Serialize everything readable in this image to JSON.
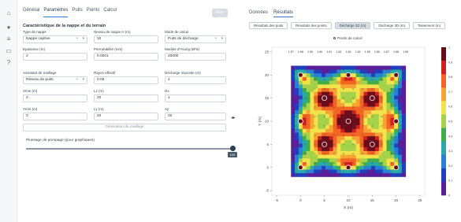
{
  "rail": {
    "icons": [
      "home-icon",
      "database-icon",
      "layers-icon",
      "monitor-icon",
      "help-icon"
    ]
  },
  "left_tabs": [
    "Général",
    "Paramètres",
    "Puits",
    "Points",
    "Calcul"
  ],
  "run_button": "Run",
  "section_title": "Caractéristique de la nappe et du terrain",
  "fields": {
    "type_nappe": {
      "label": "Type de nappe",
      "value": "Nappe captive"
    },
    "niveau_nappe": {
      "label": "Niveau de nappe H (m)",
      "value": "10"
    },
    "mode_calcul": {
      "label": "Mode de calcul",
      "value": "Puits de décharge"
    },
    "epaisseur": {
      "label": "Epaisseur (m)",
      "value": "2"
    },
    "permeabilite": {
      "label": "Perméabilité (m/s)",
      "value": "0.0001"
    },
    "module_young": {
      "label": "Module d'Young (kPa)",
      "value": "20000"
    },
    "assistant_maillage": {
      "label": "Assistant de maillage",
      "value": "Réseau de puits"
    },
    "rayon_effectif": {
      "label": "Rayon effectif",
      "value": "0.06"
    },
    "decharge_imposee": {
      "label": "Décharge imposée (m)",
      "value": "4"
    },
    "xmin": {
      "label": "Xmin (m)",
      "value": "0"
    },
    "lx": {
      "label": "Lx (m)",
      "value": "20"
    },
    "dx": {
      "label": "Dx",
      "value": "4"
    },
    "ymin": {
      "label": "Ymin (m)",
      "value": "0"
    },
    "ly": {
      "label": "Ly (m)",
      "value": "20"
    },
    "ay": {
      "label": "Ay",
      "value": "20"
    }
  },
  "mesh_button": "Génération du maillage",
  "slider": {
    "label": "Plussage de pompage (pour graphiques)",
    "value": "100",
    "fraction": 1.0
  },
  "right_tabs": [
    "Données",
    "Résultats"
  ],
  "sub_buttons": [
    "Résultats des puits",
    "Résultats des points",
    "Décharge 2D (m)",
    "Décharge 3D (m)",
    "Tassement (m)"
  ],
  "chart_data": {
    "type": "heatmap",
    "legend_entry": "Points de calcul",
    "xlabel": "X (m)",
    "ylabel": "Y (m)",
    "xlim": [
      -6,
      26
    ],
    "ylim": [
      -6,
      26
    ],
    "x_ticks": [
      -5,
      0,
      5,
      10,
      15,
      20,
      25
    ],
    "y_ticks": [
      -5,
      0,
      5,
      10,
      15,
      20,
      25
    ],
    "colorbar_ticks": [
      "1",
      "0.9",
      "0.8",
      "0.7",
      "0.6",
      "0.5",
      "0.4",
      "0.3",
      "0.2",
      "0.1",
      "0"
    ],
    "colorscale": [
      "#6a0d1a",
      "#cf1f1f",
      "#f26522",
      "#f7a334",
      "#f2e34a",
      "#a6d24a",
      "#3fae49",
      "#29a9a8",
      "#2b7fd3",
      "#1f3fbf",
      "#5a1e9a"
    ],
    "wells": [
      [
        0,
        0
      ],
      [
        0,
        10
      ],
      [
        0,
        20
      ],
      [
        10,
        0
      ],
      [
        10,
        10
      ],
      [
        20,
        0
      ],
      [
        20,
        10
      ],
      [
        20,
        20
      ],
      [
        5,
        5
      ],
      [
        15,
        5
      ],
      [
        5,
        15
      ],
      [
        15,
        15
      ],
      [
        10,
        20
      ]
    ],
    "top_labels": [
      "1.57",
      "1.58",
      "1.59",
      "1.60",
      "1.61",
      "1.62",
      "1.63",
      "1.64",
      "1.65",
      "1.66",
      "1.67",
      "1.68",
      "1.69"
    ]
  },
  "colors": {
    "accent": "#2b7bd0",
    "background": "#ffffff",
    "rail": "#f6f7f9"
  }
}
